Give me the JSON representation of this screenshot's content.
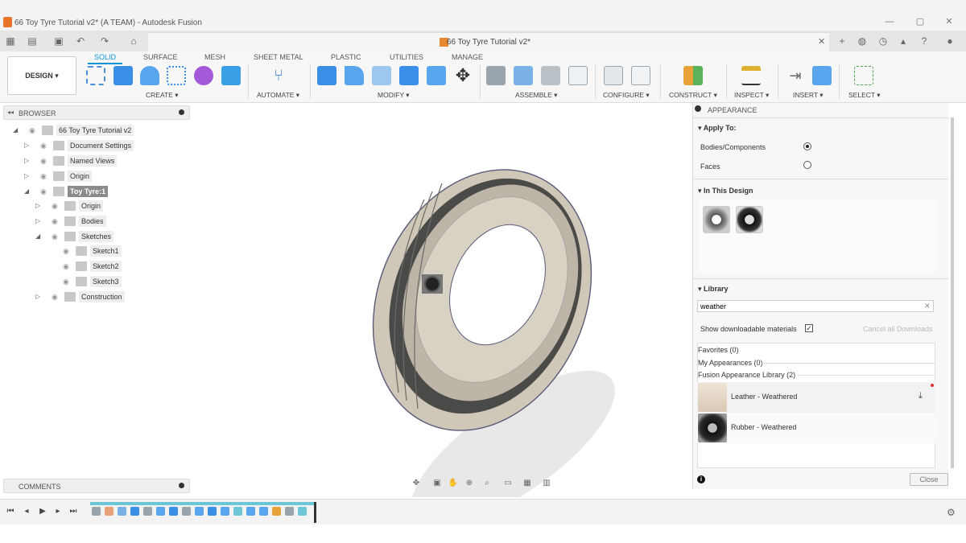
{
  "window": {
    "title": "66 Toy Tyre Tutorial v2* (A TEAM) - Autodesk Fusion",
    "controls": [
      "minimize-icon",
      "restore-icon",
      "close-icon"
    ]
  },
  "doc_tab": {
    "title": "66 Toy Tyre Tutorial v2*"
  },
  "workspace": {
    "label": "DESIGN ▾"
  },
  "ribbon_tabs": [
    "SOLID",
    "SURFACE",
    "MESH",
    "SHEET METAL",
    "PLASTIC",
    "UTILITIES",
    "MANAGE"
  ],
  "ribbon_groups": {
    "create": "CREATE ▾",
    "automate": "AUTOMATE ▾",
    "modify": "MODIFY ▾",
    "assemble": "ASSEMBLE ▾",
    "configure": "CONFIGURE ▾",
    "construct": "CONSTRUCT ▾",
    "inspect": "INSPECT ▾",
    "insert": "INSERT ▾",
    "select": "SELECT ▾"
  },
  "browser": {
    "header": "BROWSER",
    "items": [
      {
        "label": "66 Toy Tyre Tutorial v2",
        "indent": 0,
        "arrow": "◢"
      },
      {
        "label": "Document Settings",
        "indent": 1,
        "arrow": "▷"
      },
      {
        "label": "Named Views",
        "indent": 1,
        "arrow": "▷"
      },
      {
        "label": "Origin",
        "indent": 1,
        "arrow": "▷"
      },
      {
        "label": "Toy Tyre:1",
        "indent": 1,
        "arrow": "◢"
      },
      {
        "label": "Origin",
        "indent": 2,
        "arrow": "▷"
      },
      {
        "label": "Bodies",
        "indent": 2,
        "arrow": "▷"
      },
      {
        "label": "Sketches",
        "indent": 2,
        "arrow": "◢"
      },
      {
        "label": "Sketch1",
        "indent": 3,
        "arrow": ""
      },
      {
        "label": "Sketch2",
        "indent": 3,
        "arrow": ""
      },
      {
        "label": "Sketch3",
        "indent": 3,
        "arrow": ""
      },
      {
        "label": "Construction",
        "indent": 2,
        "arrow": "▷"
      }
    ]
  },
  "comments": {
    "header": "COMMENTS"
  },
  "appearance": {
    "header": "APPEARANCE",
    "apply_to": "Apply To:",
    "bodies_components": "Bodies/Components",
    "faces": "Faces",
    "in_this_design": "In This Design",
    "library": "Library",
    "search_value": "weather",
    "show_downloadable": "Show downloadable materials",
    "cancel_downloads": "Cancel all Downloads",
    "favorites": "Favorites (0)",
    "my_appearances": "My Appearances (0)",
    "fusion_library": "Fusion Appearance Library (2)",
    "results": [
      {
        "label": "Leather - Weathered"
      },
      {
        "label": "Rubber - Weathered"
      }
    ],
    "close": "Close"
  },
  "colors": {
    "accent": "#0696d7",
    "tyre_tread": "#cfc8b8",
    "tyre_dark": "#4a4a48",
    "brand_orange": "#e8732a"
  }
}
